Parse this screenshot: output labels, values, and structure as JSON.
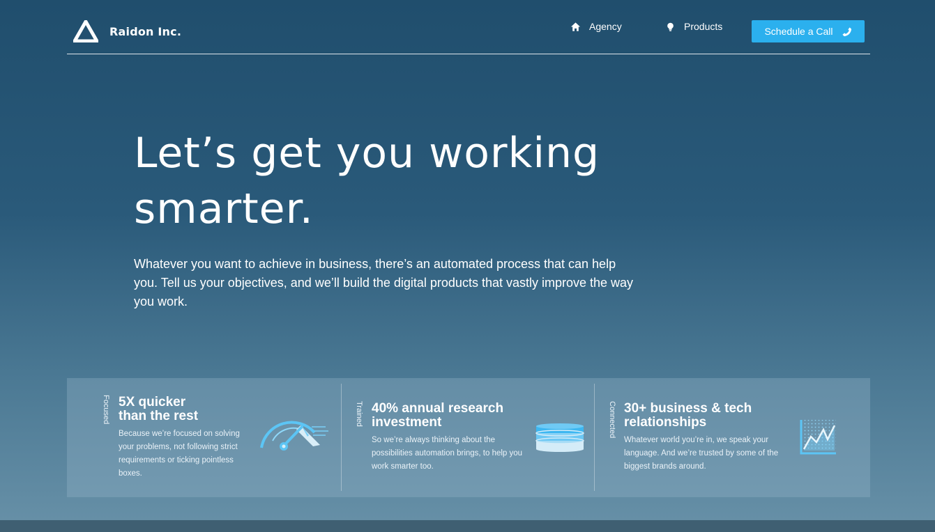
{
  "header": {
    "brand": "Raidon Inc.",
    "nav": [
      {
        "label": "Agency",
        "icon": "home-icon"
      },
      {
        "label": "Products",
        "icon": "lightbulb-icon"
      }
    ],
    "cta": {
      "label": "Schedule a Call",
      "icon": "phone-icon",
      "color": "#2bb0ee"
    }
  },
  "hero": {
    "title_line1": "Let’s get you working",
    "title_line2": "smarter.",
    "subtitle": "Whatever you want to achieve in business, there’s an automated process that can help you. Tell us your objectives, and we’ll build the digital products that vastly improve the way you work."
  },
  "features": [
    {
      "tag": "Focused",
      "title_line1": "5X quicker",
      "title_line2": "than the rest",
      "description": "Because we’re focused on solving your problems, not following strict requirements or ticking pointless boxes.",
      "icon": "speedometer-icon"
    },
    {
      "tag": "Trained",
      "title_line1": "40% annual research",
      "title_line2": "investment",
      "description": "So we’re always thinking about the possibilities automation brings, to help you work smarter too.",
      "icon": "database-icon"
    },
    {
      "tag": "Connected",
      "title_line1": "30+ business & tech",
      "title_line2": "relationships",
      "description": "Whatever world you’re in, we speak your language. And we’re trusted by some of the biggest brands around.",
      "icon": "line-chart-icon"
    }
  ],
  "colors": {
    "accent": "#2bb0ee",
    "background_top": "#204e6d",
    "background_bottom": "#6891a8"
  }
}
